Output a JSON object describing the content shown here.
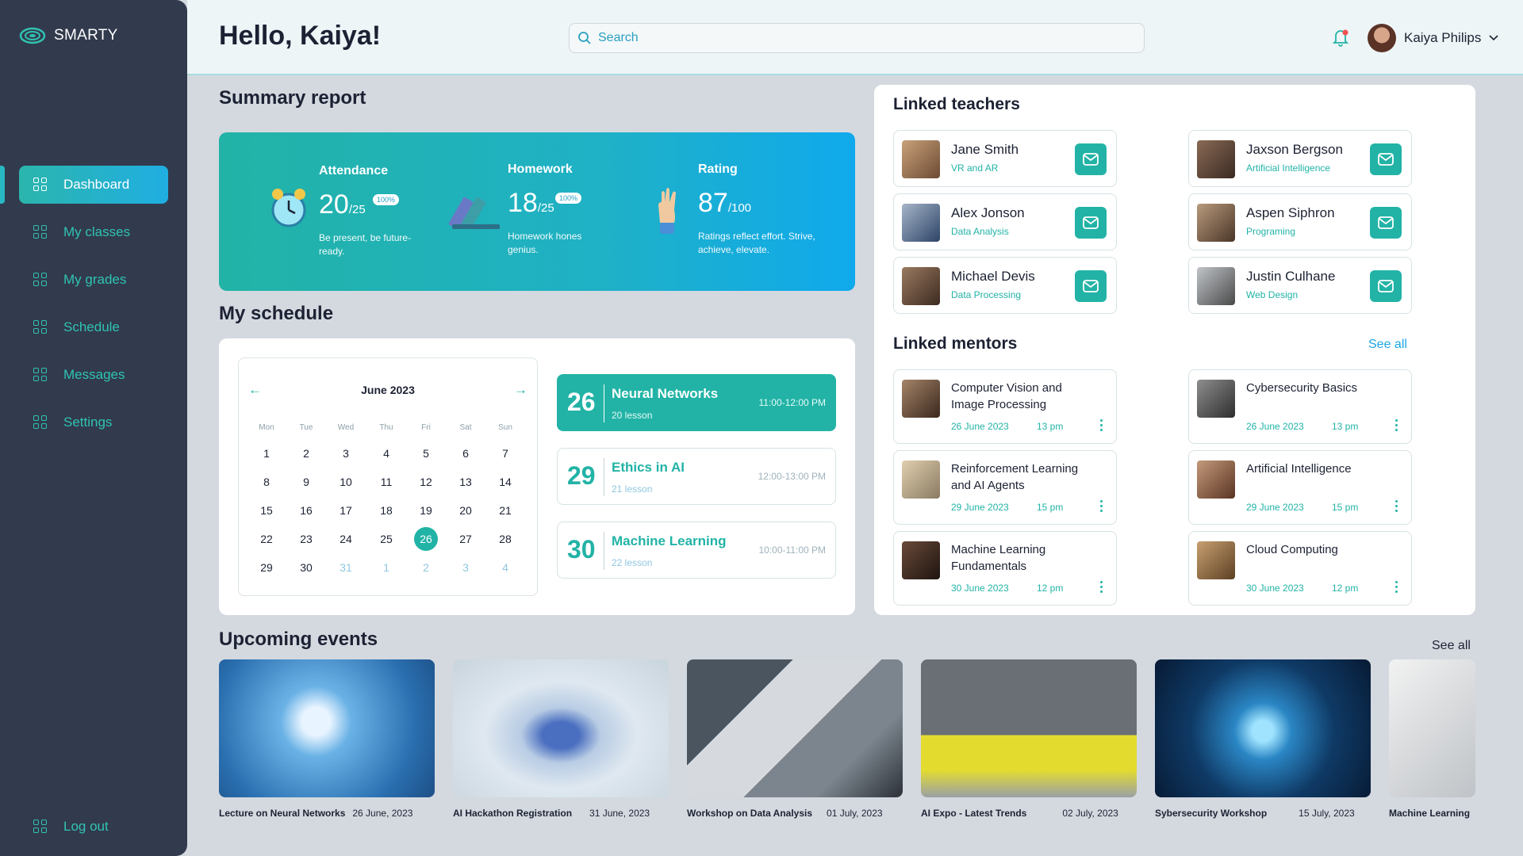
{
  "app": {
    "name": "SMARTY"
  },
  "sidebar": {
    "items": [
      {
        "label": "Dashboard"
      },
      {
        "label": "My classes"
      },
      {
        "label": "My grades"
      },
      {
        "label": "Schedule"
      },
      {
        "label": "Messages"
      },
      {
        "label": "Settings"
      }
    ],
    "logout_label": "Log out"
  },
  "header": {
    "greeting": "Hello, Kaiya!",
    "search_placeholder": "Search",
    "user_name": "Kaiya Philips"
  },
  "summary": {
    "title": "Summary report",
    "attendance": {
      "label": "Attendance",
      "value": "20",
      "total": "/25",
      "badge": "100%",
      "desc": "Be present, be future-ready."
    },
    "homework": {
      "label": "Homework",
      "value": "18",
      "total": "/25",
      "badge": "100%",
      "desc": "Homework hones genius."
    },
    "rating": {
      "label": "Rating",
      "value": "87",
      "total": "/100",
      "desc": "Ratings reflect effort. Strive, achieve, elevate."
    }
  },
  "schedule": {
    "title": "My schedule",
    "month": "June 2023",
    "weekdays": [
      "Mon",
      "Tue",
      "Wed",
      "Thu",
      "Fri",
      "Sat",
      "Sun"
    ],
    "weeks": [
      [
        "1",
        "2",
        "3",
        "4",
        "5",
        "6",
        "7"
      ],
      [
        "8",
        "9",
        "10",
        "11",
        "12",
        "13",
        "14"
      ],
      [
        "15",
        "16",
        "17",
        "18",
        "19",
        "20",
        "21"
      ],
      [
        "22",
        "23",
        "24",
        "25",
        "26",
        "27",
        "28"
      ],
      [
        "29",
        "30",
        "31",
        "1",
        "2",
        "3",
        "4"
      ]
    ],
    "selected_day": "26",
    "events": [
      {
        "day": "26",
        "title": "Neural Networks",
        "lessons": "20 lesson",
        "time": "11:00-12:00 PM"
      },
      {
        "day": "29",
        "title": "Ethics in AI",
        "lessons": "21 lesson",
        "time": "12:00-13:00 PM"
      },
      {
        "day": "30",
        "title": "Machine Learning",
        "lessons": "22 lesson",
        "time": "10:00-11:00 PM"
      }
    ]
  },
  "teachers": {
    "title": "Linked teachers",
    "items": [
      {
        "name": "Jane Smith",
        "subject": "VR and AR"
      },
      {
        "name": "Jaxson Bergson",
        "subject": "Artificial Intelligence"
      },
      {
        "name": "Alex Jonson",
        "subject": "Data Analysis"
      },
      {
        "name": "Aspen Siphron",
        "subject": "Programing"
      },
      {
        "name": "Michael Devis",
        "subject": "Data Processing"
      },
      {
        "name": "Justin Culhane",
        "subject": "Web Design"
      }
    ]
  },
  "mentors": {
    "title": "Linked mentors",
    "see_all": "See all",
    "items": [
      {
        "topic": "Computer Vision and Image Processing",
        "date": "26 June 2023",
        "time": "13 pm"
      },
      {
        "topic": "Cybersecurity Basics",
        "date": "26 June 2023",
        "time": "13 pm"
      },
      {
        "topic": "Reinforcement Learning and AI Agents",
        "date": "29 June 2023",
        "time": "15 pm"
      },
      {
        "topic": "Artificial Intelligence",
        "date": "29 June 2023",
        "time": "15 pm"
      },
      {
        "topic": "Machine  Learning Fundamentals",
        "date": "30 June 2023",
        "time": "12 pm"
      },
      {
        "topic": "Cloud Computing",
        "date": "30 June 2023",
        "time": "12 pm"
      }
    ]
  },
  "events": {
    "title": "Upcoming events",
    "see_all": "See all",
    "items": [
      {
        "title": "Lecture on Neural Networks",
        "date": "26 June, 2023"
      },
      {
        "title": "AI Hackathon Registration",
        "date": "31 June, 2023"
      },
      {
        "title": "Workshop on Data Analysis",
        "date": "01 July, 2023"
      },
      {
        "title": "AI Expo - Latest Trends",
        "date": "02 July, 2023"
      },
      {
        "title": "Sybersecurity Workshop",
        "date": "15 July, 2023"
      },
      {
        "title": "Machine Learning",
        "date": ""
      }
    ]
  },
  "colors": {
    "accent": "#22b3a6",
    "sidebar": "#323a4d",
    "blue": "#10a9ec"
  },
  "icons": [
    "logo-icon",
    "grid-icon",
    "search-icon",
    "bell-icon",
    "chevron-down-icon",
    "mail-icon",
    "kebab-icon",
    "arrow-left-icon",
    "arrow-right-icon",
    "clock-icon",
    "books-icon",
    "hand-icon"
  ]
}
